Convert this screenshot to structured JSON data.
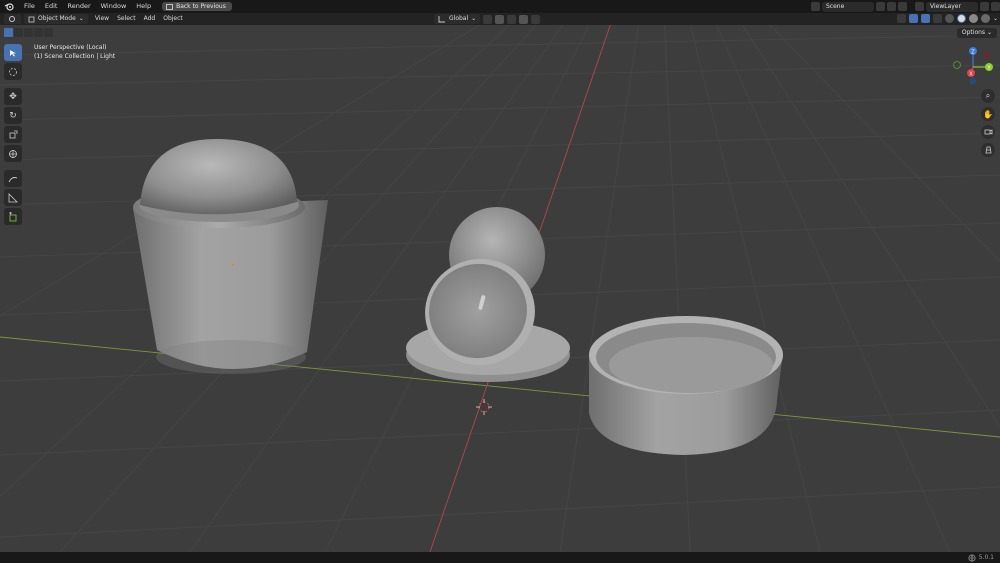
{
  "topbar": {
    "menus": [
      "File",
      "Edit",
      "Render",
      "Window",
      "Help"
    ],
    "back_button": "Back to Previous",
    "scene": "Scene",
    "view_layer": "ViewLayer"
  },
  "viewport_header": {
    "mode": "Object Mode",
    "menus": [
      "View",
      "Select",
      "Add",
      "Object"
    ],
    "transform_orientation": "Global",
    "options": "Options"
  },
  "overlay": {
    "perspective": "User Perspective (Local)",
    "collection": "(1) Scene Collection | Light"
  },
  "gizmo": {
    "x": "X",
    "y": "Y",
    "z": "Z"
  },
  "status": {
    "version": "5.0.1"
  },
  "colors": {
    "accent": "#4772b3",
    "x_axis": "#e0424c",
    "y_axis": "#8bcd2b",
    "z_axis": "#3b7dd8",
    "grid_bg": "#3d3d3d"
  },
  "icons": [
    "blender-logo-icon",
    "cursor-tool-icon",
    "move-icon",
    "rotate-icon",
    "scale-icon",
    "transform-icon",
    "annotate-icon",
    "measure-icon",
    "add-cube-icon",
    "zoom-icon",
    "hand-icon",
    "camera-icon",
    "grid-view-icon",
    "globe-icon"
  ]
}
